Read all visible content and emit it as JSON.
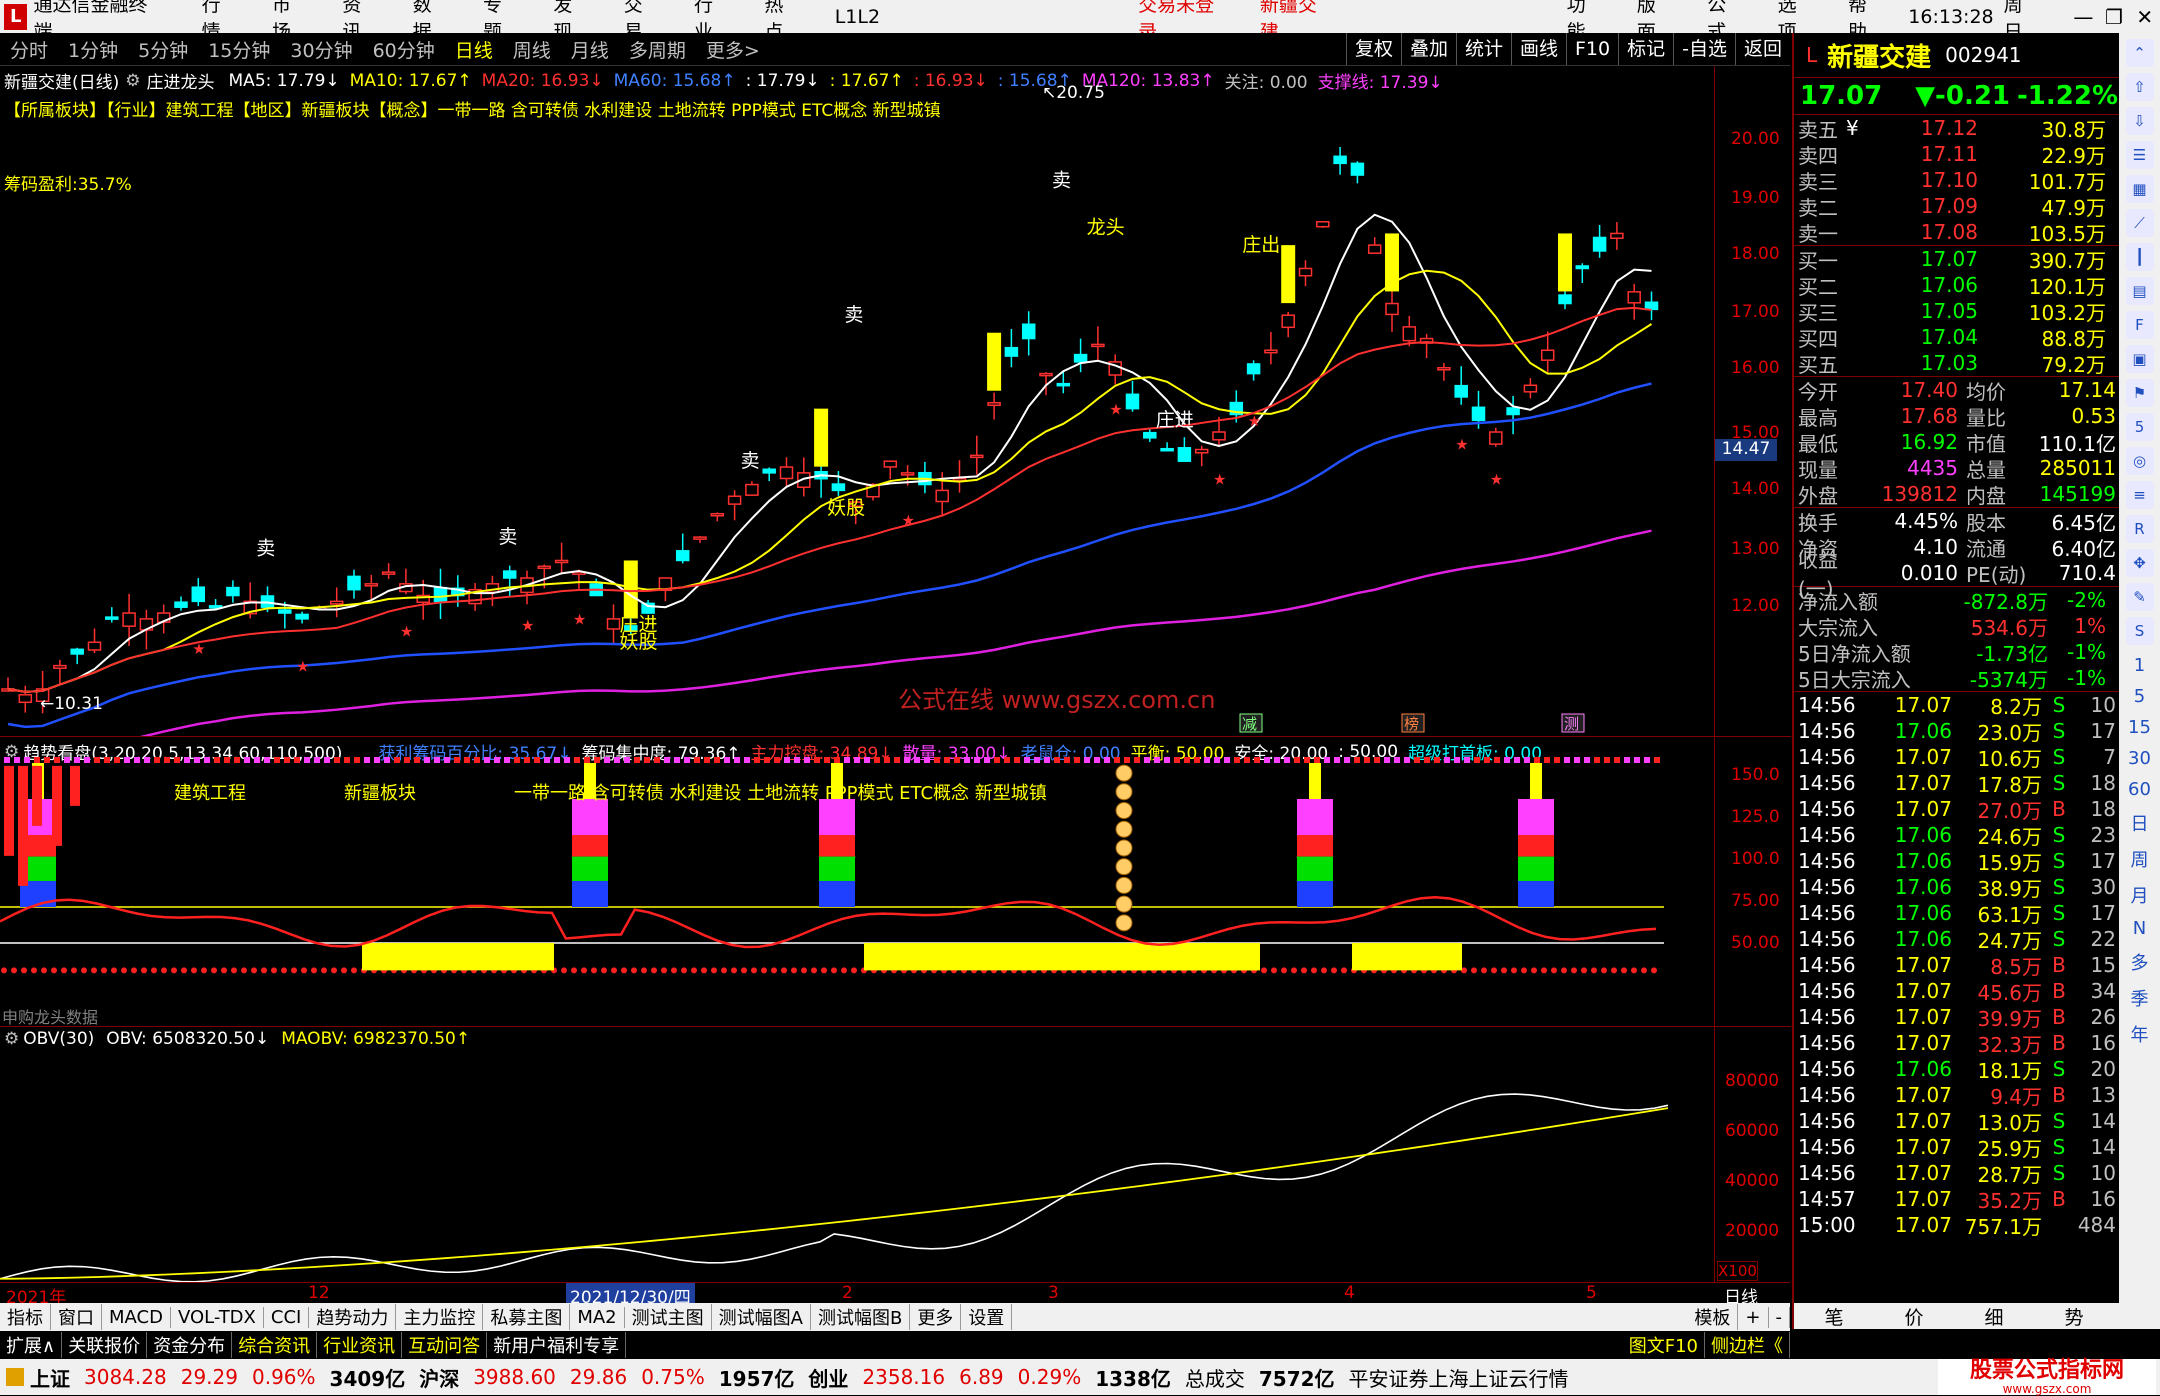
{
  "menubar": {
    "app_title": "通达信金融终端",
    "items": [
      "行情",
      "市场",
      "资讯",
      "数据",
      "专题",
      "发现",
      "交易",
      "行业",
      "热点",
      "L1L2"
    ],
    "center_items": [
      "交易未登录",
      "新疆交建"
    ],
    "right_items": [
      "功能",
      "版面",
      "公式",
      "选项",
      "帮助"
    ],
    "clock": "16:13:28",
    "weekday": "周日"
  },
  "periodbar": {
    "periods": [
      "分时",
      "1分钟",
      "5分钟",
      "15分钟",
      "30分钟",
      "60分钟",
      "日线",
      "周线",
      "月线",
      "多周期",
      "更多>"
    ],
    "active": "日线",
    "tools": [
      "复权",
      "叠加",
      "统计",
      "画线",
      "F10",
      "标记",
      "-自选",
      "返回"
    ]
  },
  "main_chart": {
    "stock_label": "新疆交建(日线)",
    "formula_name": "庄进龙头",
    "ma_legend": [
      {
        "label": "MA5: 17.79↓",
        "color": "#ffffff"
      },
      {
        "label": "MA10: 17.67↑",
        "color": "#ffff00"
      },
      {
        "label": "MA20: 16.93↓",
        "color": "#ff3030"
      },
      {
        "label": "MA60: 15.68↑",
        "color": "#4080ff"
      },
      {
        "label": ": 17.79↓",
        "color": "#ffffff"
      },
      {
        "label": ": 17.67↑",
        "color": "#ffff00"
      },
      {
        "label": ": 16.93↓",
        "color": "#ff3030"
      },
      {
        "label": ": 15.68↑",
        "color": "#4080ff"
      },
      {
        "label": "MA120: 13.83↑",
        "color": "#ff40ff"
      },
      {
        "label": "关注: 0.00",
        "color": "#c0c0c0"
      },
      {
        "label": "支撑线: 17.39↓",
        "color": "#ff40ff"
      }
    ],
    "concept_line": "【所属板块】【行业】建筑工程【地区】新疆板块【概念】一带一路 含可转债 水利建设 土地流转 PPP模式 ETC概念 新型城镇",
    "chip_profit": "筹码盈利:35.7%",
    "y_labels": [
      "20.00",
      "19.00",
      "18.00",
      "17.00",
      "16.00",
      "15.00",
      "14.00",
      "13.00",
      "12.00"
    ],
    "current_price_tag": "14.47",
    "high_label": "20.75",
    "low_label": "10.31",
    "watermark": "公式在线  www.gszx.com.cn",
    "markers": [
      "卖",
      "卖",
      "卖",
      "卖",
      "卖",
      "龙头",
      "庄出",
      "庄进",
      "庄进",
      "妖股",
      "妖股"
    ],
    "event_tags": [
      "减",
      "榜",
      "测"
    ]
  },
  "indicator1": {
    "title": "趋势看盘(3,20,20,5,13,34,60,110,500)",
    "legend": [
      {
        "label": "获利筹码百分比: 35.67↓",
        "color": "#4080ff"
      },
      {
        "label": "筹码集中度: 79.36↑",
        "color": "#ffffff"
      },
      {
        "label": "主力控盘: 34.89↓",
        "color": "#ff3030"
      },
      {
        "label": "散量: 33.00↓",
        "color": "#ff40ff"
      },
      {
        "label": "老鼠仓: 0.00",
        "color": "#4080ff"
      },
      {
        "label": "平衡: 50.00",
        "color": "#ffff00"
      },
      {
        "label": "安全: 20.00",
        "color": "#ffffff"
      },
      {
        "label": ": 50.00",
        "color": "#ffffff"
      },
      {
        "label": "超级打首板: 0.00",
        "color": "#00ffff"
      }
    ],
    "overlay_text": [
      "建筑工程",
      "新疆板块",
      "一带一路 含可转债 水利建设 土地流转 PPP模式 ETC概念 新型城镇"
    ],
    "y_labels": [
      "150.0",
      "125.0",
      "100.0",
      "75.00",
      "50.00"
    ],
    "bottom_left_text": "申购龙头数据"
  },
  "indicator2": {
    "title": "OBV(30)",
    "obv": "OBV: 6508320.50↓",
    "maobv": "MAOBV: 6982370.50↑",
    "y_labels": [
      "80000",
      "60000",
      "40000",
      "20000"
    ],
    "unit": "X100"
  },
  "date_axis": {
    "labels": [
      "2021年",
      "12",
      "2021/12/30/四",
      "2",
      "3",
      "4",
      "5"
    ],
    "right_label": "日线"
  },
  "tabs": {
    "items": [
      "指标",
      "窗口",
      "MACD",
      "VOL-TDX",
      "CCI",
      "趋势动力",
      "主力监控",
      "私募主图",
      "MA2",
      "测试主图",
      "测试幅图A",
      "测试幅图B",
      "更多",
      "设置"
    ],
    "right": "模板"
  },
  "subbar": {
    "items": [
      "扩展∧",
      "关联报价",
      "资金分布",
      "综合资讯",
      "行业资讯",
      "互动问答",
      "新用户福利专享"
    ],
    "right": [
      "图文F10",
      "侧边栏《"
    ]
  },
  "quote_panel": {
    "name": "新疆交建",
    "code": "002941",
    "price": "17.07",
    "change": "▼-0.21",
    "change_pct": "-1.22%",
    "asks": [
      {
        "label": "卖五",
        "flag": "¥",
        "price": "17.12",
        "vol": "30.8万"
      },
      {
        "label": "卖四",
        "flag": "",
        "price": "17.11",
        "vol": "22.9万"
      },
      {
        "label": "卖三",
        "flag": "",
        "price": "17.10",
        "vol": "101.7万"
      },
      {
        "label": "卖二",
        "flag": "",
        "price": "17.09",
        "vol": "47.9万"
      },
      {
        "label": "卖一",
        "flag": "",
        "price": "17.08",
        "vol": "103.5万"
      }
    ],
    "bids": [
      {
        "label": "买一",
        "price": "17.07",
        "vol": "390.7万"
      },
      {
        "label": "买二",
        "price": "17.06",
        "vol": "120.1万"
      },
      {
        "label": "买三",
        "price": "17.05",
        "vol": "103.2万"
      },
      {
        "label": "买四",
        "price": "17.04",
        "vol": "88.8万"
      },
      {
        "label": "买五",
        "price": "17.03",
        "vol": "79.2万"
      }
    ],
    "stats": [
      {
        "k1": "今开",
        "v1": "17.40",
        "c1": "#ff3030",
        "k2": "均价",
        "v2": "17.14",
        "c2": "#ffff00"
      },
      {
        "k1": "最高",
        "v1": "17.68",
        "c1": "#ff3030",
        "k2": "量比",
        "v2": "0.53",
        "c2": "#ffff00"
      },
      {
        "k1": "最低",
        "v1": "16.92",
        "c1": "#00ff00",
        "k2": "市值",
        "v2": "110.1亿",
        "c2": "#ffffff"
      },
      {
        "k1": "现量",
        "v1": "4435",
        "c1": "#ff40ff",
        "k2": "总量",
        "v2": "285011",
        "c2": "#ffff00"
      },
      {
        "k1": "外盘",
        "v1": "139812",
        "c1": "#ff3030",
        "k2": "内盘",
        "v2": "145199",
        "c2": "#00ff00"
      }
    ],
    "stats2": [
      {
        "k1": "换手",
        "v1": "4.45%",
        "k2": "股本",
        "v2": "6.45亿"
      },
      {
        "k1": "净资",
        "v1": "4.10",
        "k2": "流通",
        "v2": "6.40亿"
      },
      {
        "k1": "收益(一)",
        "v1": "0.010",
        "k2": "PE(动)",
        "v2": "710.4"
      }
    ],
    "flows": [
      {
        "k": "净流入额",
        "v": "-872.8万",
        "p": "-2%",
        "c": "#00ff00"
      },
      {
        "k": "大宗流入",
        "v": "534.6万",
        "p": "1%",
        "c": "#ff3030"
      },
      {
        "k": "5日净流入额",
        "v": "-1.73亿",
        "p": "-1%",
        "c": "#00ff00"
      },
      {
        "k": "5日大宗流入",
        "v": "-5374万",
        "p": "-1%",
        "c": "#00ff00"
      }
    ],
    "ticks": [
      {
        "t": "14:56",
        "p": "17.07",
        "v": "8.2万",
        "bs": "S",
        "n": "10"
      },
      {
        "t": "14:56",
        "p": "17.06",
        "v": "23.0万",
        "bs": "S",
        "n": "17"
      },
      {
        "t": "14:56",
        "p": "17.07",
        "v": "10.6万",
        "bs": "S",
        "n": "7"
      },
      {
        "t": "14:56",
        "p": "17.07",
        "v": "17.8万",
        "bs": "S",
        "n": "18"
      },
      {
        "t": "14:56",
        "p": "17.07",
        "v": "27.0万",
        "bs": "B",
        "n": "18"
      },
      {
        "t": "14:56",
        "p": "17.06",
        "v": "24.6万",
        "bs": "S",
        "n": "23"
      },
      {
        "t": "14:56",
        "p": "17.06",
        "v": "15.9万",
        "bs": "S",
        "n": "17"
      },
      {
        "t": "14:56",
        "p": "17.06",
        "v": "38.9万",
        "bs": "S",
        "n": "30"
      },
      {
        "t": "14:56",
        "p": "17.06",
        "v": "63.1万",
        "bs": "S",
        "n": "17"
      },
      {
        "t": "14:56",
        "p": "17.06",
        "v": "24.7万",
        "bs": "S",
        "n": "22"
      },
      {
        "t": "14:56",
        "p": "17.07",
        "v": "8.5万",
        "bs": "B",
        "n": "15"
      },
      {
        "t": "14:56",
        "p": "17.07",
        "v": "45.6万",
        "bs": "B",
        "n": "34"
      },
      {
        "t": "14:56",
        "p": "17.07",
        "v": "39.9万",
        "bs": "B",
        "n": "26"
      },
      {
        "t": "14:56",
        "p": "17.07",
        "v": "32.3万",
        "bs": "B",
        "n": "16"
      },
      {
        "t": "14:56",
        "p": "17.06",
        "v": "18.1万",
        "bs": "S",
        "n": "20"
      },
      {
        "t": "14:56",
        "p": "17.07",
        "v": "9.4万",
        "bs": "B",
        "n": "13"
      },
      {
        "t": "14:56",
        "p": "17.07",
        "v": "13.0万",
        "bs": "S",
        "n": "14"
      },
      {
        "t": "14:56",
        "p": "17.07",
        "v": "25.9万",
        "bs": "S",
        "n": "14"
      },
      {
        "t": "14:56",
        "p": "17.07",
        "v": "28.7万",
        "bs": "S",
        "n": "10"
      },
      {
        "t": "14:57",
        "p": "17.07",
        "v": "35.2万",
        "bs": "B",
        "n": "16"
      },
      {
        "t": "15:00",
        "p": "17.07",
        "v": "757.1万",
        "bs": "",
        "n": "484"
      }
    ],
    "bottom_tabs": [
      "笔",
      "价",
      "细",
      "势"
    ]
  },
  "sidebar": {
    "numbers": [
      "1",
      "5",
      "15",
      "30",
      "60"
    ],
    "periods": [
      "日",
      "周",
      "月",
      "N",
      "多",
      "季",
      "年"
    ]
  },
  "statusbar": {
    "indexes": [
      {
        "name": "上证",
        "val": "3084.28",
        "chg": "29.29",
        "pct": "0.96%",
        "amt": "3409亿"
      },
      {
        "name": "沪深",
        "val": "3988.60",
        "chg": "29.86",
        "pct": "0.75%",
        "amt": "1957亿"
      },
      {
        "name": "创业",
        "val": "2358.16",
        "chg": "6.89",
        "pct": "0.29%",
        "amt": "1338亿"
      }
    ],
    "total_label": "总成交",
    "total_value": "7572亿",
    "broker": "平安证券上海上证云行情",
    "logo_text": "股票公式指标网",
    "logo_url": "www.gszx.com"
  },
  "colors": {
    "up": "#ff3030",
    "down": "#00ffff",
    "accent": "#ffff00",
    "frame": "#800000"
  }
}
